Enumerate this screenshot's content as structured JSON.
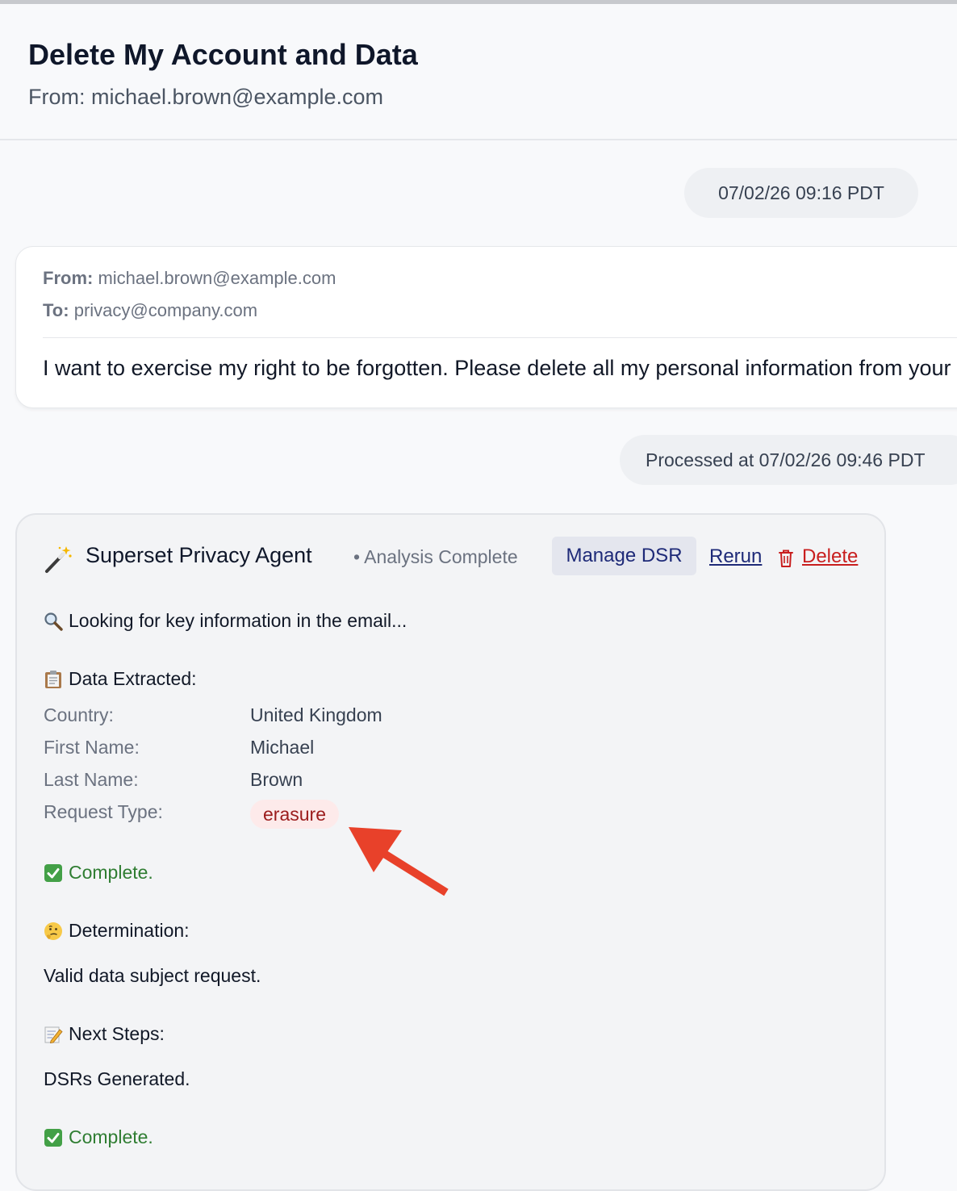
{
  "header": {
    "title": "Delete My Account and Data",
    "from": "From: michael.brown@example.com"
  },
  "timestamp": "07/02/26 09:16 PDT",
  "email": {
    "from_label": "From:",
    "from_value": "michael.brown@example.com",
    "to_label": "To:",
    "to_value": "privacy@company.com",
    "body": "I want to exercise my right to be forgotten. Please delete all my personal information from your systems."
  },
  "processed": "Processed at 07/02/26 09:46 PDT",
  "agent": {
    "name": "Superset Privacy Agent",
    "status": "• Analysis Complete",
    "manage_label": "Manage DSR",
    "rerun_label": "Rerun",
    "delete_label": "Delete",
    "looking": "Looking for key information in the email...",
    "extracted_heading": "Data Extracted:",
    "fields": [
      {
        "label": "Country:",
        "value": "United Kingdom"
      },
      {
        "label": "First Name:",
        "value": "Michael"
      },
      {
        "label": "Last Name:",
        "value": "Brown"
      },
      {
        "label": "Request Type:",
        "value": "erasure"
      }
    ],
    "complete_1": "Complete.",
    "determination_heading": "Determination:",
    "determination_text": "Valid data subject request.",
    "next_heading": "Next Steps:",
    "next_text": "DSRs Generated.",
    "complete_2": "Complete."
  },
  "colors": {
    "accent_navy": "#1e2a78",
    "delete_red": "#c81e1e",
    "success_green": "#2f7d32",
    "badge_bg": "#fdeaea",
    "arrow_red": "#e8412a"
  }
}
